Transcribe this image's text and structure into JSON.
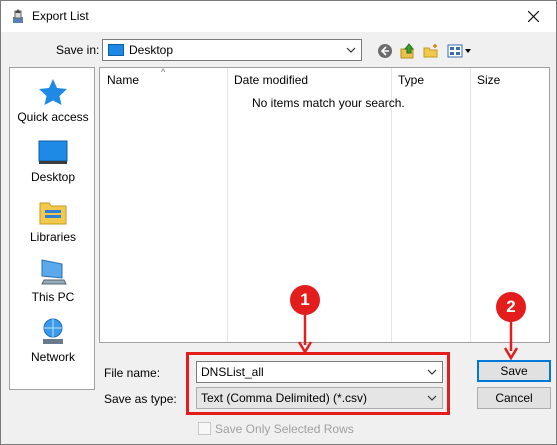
{
  "window": {
    "title": "Export List"
  },
  "save_in": {
    "label": "Save in:",
    "value": "Desktop"
  },
  "toolbar": {
    "icons": [
      "back-icon",
      "up-folder-icon",
      "new-folder-icon",
      "view-menu-icon"
    ]
  },
  "places": [
    {
      "label": "Quick access",
      "icon": "star-icon"
    },
    {
      "label": "Desktop",
      "icon": "desktop-icon"
    },
    {
      "label": "Libraries",
      "icon": "libraries-icon"
    },
    {
      "label": "This PC",
      "icon": "pc-icon"
    },
    {
      "label": "Network",
      "icon": "network-icon"
    }
  ],
  "file_list": {
    "columns": [
      "Name",
      "Date modified",
      "Type",
      "Size"
    ],
    "empty_message": "No items match your search."
  },
  "file_name": {
    "label": "File name:",
    "value": "DNSList_all"
  },
  "save_as_type": {
    "label": "Save as type:",
    "value": "Text (Comma Delimited) (*.csv)"
  },
  "buttons": {
    "save": "Save",
    "cancel": "Cancel"
  },
  "option": {
    "label": "Save Only Selected Rows",
    "checked": false,
    "enabled": false
  },
  "annotations": [
    {
      "number": "1",
      "color": "#e31c1c"
    },
    {
      "number": "2",
      "color": "#e31c1c"
    }
  ],
  "colors": {
    "accent": "#0078d7",
    "annotation": "#e31c1c"
  }
}
